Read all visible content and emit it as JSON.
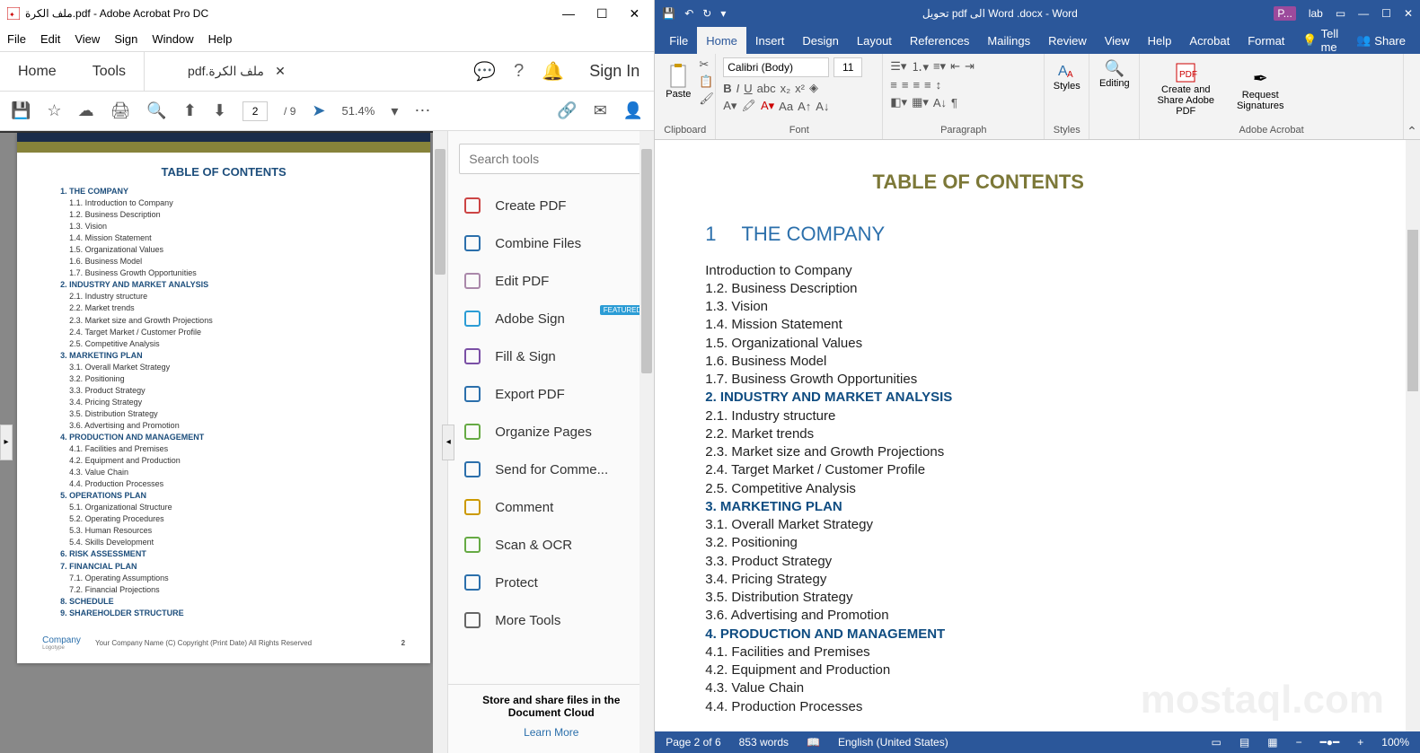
{
  "acrobat": {
    "title": "ملف الكرة.pdf - Adobe Acrobat Pro DC",
    "menu": [
      "File",
      "Edit",
      "View",
      "Sign",
      "Window",
      "Help"
    ],
    "tab_home": "Home",
    "tab_tools": "Tools",
    "doc_tab": "pdf.ملف الكرة",
    "sign_in": "Sign In",
    "page_current": "2",
    "page_total": "/ 9",
    "zoom": "51.4%",
    "pdf": {
      "toc_title": "TABLE OF CONTENTS",
      "sections": [
        {
          "h": "1. THE COMPANY",
          "items": [
            "1.1. Introduction to Company",
            "1.2. Business Description",
            "1.3. Vision",
            "1.4. Mission Statement",
            "1.5. Organizational Values",
            "1.6. Business Model",
            "1.7. Business Growth Opportunities"
          ]
        },
        {
          "h": "2. INDUSTRY AND MARKET ANALYSIS",
          "items": [
            "2.1. Industry structure",
            "2.2. Market trends",
            "2.3. Market size and Growth Projections",
            "2.4. Target Market / Customer Profile",
            "2.5. Competitive Analysis"
          ]
        },
        {
          "h": "3. MARKETING PLAN",
          "items": [
            "3.1. Overall Market Strategy",
            "3.2. Positioning",
            "3.3. Product Strategy",
            "3.4. Pricing Strategy",
            "3.5. Distribution Strategy",
            "3.6. Advertising and Promotion"
          ]
        },
        {
          "h": "4. PRODUCTION AND MANAGEMENT",
          "items": [
            "4.1. Facilities and Premises",
            "4.2. Equipment and Production",
            "4.3. Value Chain",
            "4.4. Production Processes"
          ]
        },
        {
          "h": "5. OPERATIONS PLAN",
          "items": [
            "5.1. Organizational Structure",
            "5.2. Operating Procedures",
            "5.3. Human Resources",
            "5.4. Skills Development"
          ]
        },
        {
          "h": "6. RISK ASSESSMENT",
          "items": []
        },
        {
          "h": "7. FINANCIAL PLAN",
          "items": [
            "7.1. Operating Assumptions",
            "7.2. Financial Projections"
          ]
        },
        {
          "h": "8. SCHEDULE",
          "items": []
        },
        {
          "h": "9. SHAREHOLDER STRUCTURE",
          "items": []
        }
      ],
      "footer_logo": "Company",
      "footer_logo_sub": "Logotype",
      "footer_copy": "Your Company Name (C) Copyright (Print Date) All Rights Reserved",
      "footer_page": "2"
    },
    "tools": {
      "search_placeholder": "Search tools",
      "items": [
        "Create PDF",
        "Combine Files",
        "Edit PDF",
        "Adobe Sign",
        "Fill & Sign",
        "Export PDF",
        "Organize Pages",
        "Send for Comme...",
        "Comment",
        "Scan & OCR",
        "Protect",
        "More Tools"
      ],
      "featured_badge": "FEATURED",
      "footer_line1": "Store and share files in the",
      "footer_line2": "Document Cloud",
      "learn_more": "Learn More"
    }
  },
  "word": {
    "title": "تحويل pdf الى Word .docx - Word",
    "account_label": "lab",
    "quick_access_prefix": "P...",
    "ribbon_tabs": [
      "File",
      "Home",
      "Insert",
      "Design",
      "Layout",
      "References",
      "Mailings",
      "Review",
      "View",
      "Help",
      "Acrobat",
      "Format"
    ],
    "tell_me": "Tell me",
    "share": "Share",
    "ribbon": {
      "paste": "Paste",
      "clipboard_label": "Clipboard",
      "font_name": "Calibri (Body)",
      "font_size": "11",
      "font_label": "Font",
      "paragraph_label": "Paragraph",
      "styles": "Styles",
      "styles_label": "Styles",
      "editing": "Editing",
      "create_share": "Create and Share Adobe PDF",
      "request_sig": "Request Signatures",
      "adobe_label": "Adobe Acrobat"
    },
    "doc": {
      "toc_title": "TABLE OF CONTENTS",
      "heading_num": "1",
      "heading_text": "THE COMPANY",
      "lines": [
        {
          "t": "Introduction to Company",
          "k": "plain"
        },
        {
          "t": "1.2. Business Description",
          "k": "plain"
        },
        {
          "t": "1.3. Vision",
          "k": "plain"
        },
        {
          "t": "1.4. Mission Statement",
          "k": "plain"
        },
        {
          "t": "1.5. Organizational Values",
          "k": "plain"
        },
        {
          "t": "1.6. Business Model",
          "k": "plain"
        },
        {
          "t": "1.7. Business Growth Opportunities",
          "k": "plain"
        },
        {
          "t": "2. INDUSTRY AND MARKET ANALYSIS",
          "k": "h2"
        },
        {
          "t": "2.1. Industry structure",
          "k": "plain"
        },
        {
          "t": "2.2. Market trends",
          "k": "plain"
        },
        {
          "t": "2.3. Market size and Growth Projections",
          "k": "plain"
        },
        {
          "t": "2.4. Target Market / Customer Profile",
          "k": "plain"
        },
        {
          "t": "2.5. Competitive Analysis",
          "k": "plain"
        },
        {
          "t": "3. MARKETING PLAN",
          "k": "h2"
        },
        {
          "t": "3.1. Overall Market Strategy",
          "k": "plain"
        },
        {
          "t": "3.2. Positioning",
          "k": "plain"
        },
        {
          "t": "3.3. Product Strategy",
          "k": "plain"
        },
        {
          "t": "3.4. Pricing Strategy",
          "k": "plain"
        },
        {
          "t": "3.5. Distribution Strategy",
          "k": "plain"
        },
        {
          "t": "3.6. Advertising and Promotion",
          "k": "plain"
        },
        {
          "t": "4. PRODUCTION AND MANAGEMENT",
          "k": "h2"
        },
        {
          "t": "4.1. Facilities and Premises",
          "k": "plain"
        },
        {
          "t": "4.2. Equipment and Production",
          "k": "plain"
        },
        {
          "t": "4.3. Value Chain",
          "k": "plain"
        },
        {
          "t": "4.4. Production Processes",
          "k": "plain"
        }
      ]
    },
    "status": {
      "page": "Page 2 of 6",
      "words": "853 words",
      "lang": "English (United States)",
      "zoom": "100%"
    }
  }
}
